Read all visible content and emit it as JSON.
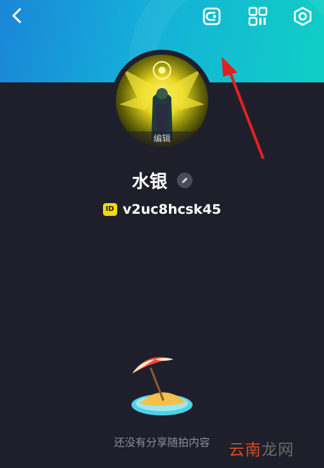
{
  "profile": {
    "avatar_edit_label": "编辑",
    "name": "水银",
    "id_badge": "ID",
    "user_id": "v2uc8hcsk45"
  },
  "empty_state": {
    "message": "还没有分享随拍内容"
  },
  "watermark": {
    "part1": "云南",
    "part2": "龙网"
  },
  "colors": {
    "header_start": "#1a86d8",
    "header_end": "#10cfc4",
    "background": "#1f1f2c",
    "id_badge": "#f6d80c",
    "annotation_arrow": "#e02020"
  },
  "icons": {
    "back": "chevron-left-icon",
    "wallet": "wallet-icon",
    "qr": "qr-code-icon",
    "settings": "hexagon-settings-icon",
    "edit": "pencil-icon",
    "empty": "beach-umbrella-icon"
  }
}
